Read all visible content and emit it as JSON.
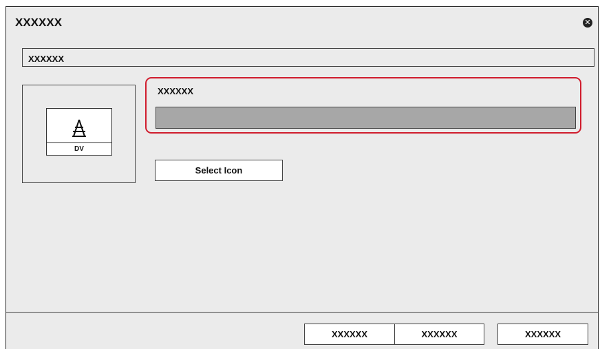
{
  "dialog": {
    "title": "XXXXXX",
    "close_icon": "close-icon"
  },
  "name_field": {
    "value": "XXXXXX"
  },
  "icon_preview": {
    "icon": "antenna-tower-icon",
    "label": "DV"
  },
  "source_section": {
    "label": "XXXXXX",
    "input_value": "",
    "highlight_color": "#d01c2d"
  },
  "select_icon_button": {
    "label": "Select Icon"
  },
  "footer": {
    "buttons": [
      {
        "label": "XXXXXX"
      },
      {
        "label": "XXXXXX"
      },
      {
        "label": "XXXXXX"
      }
    ]
  }
}
